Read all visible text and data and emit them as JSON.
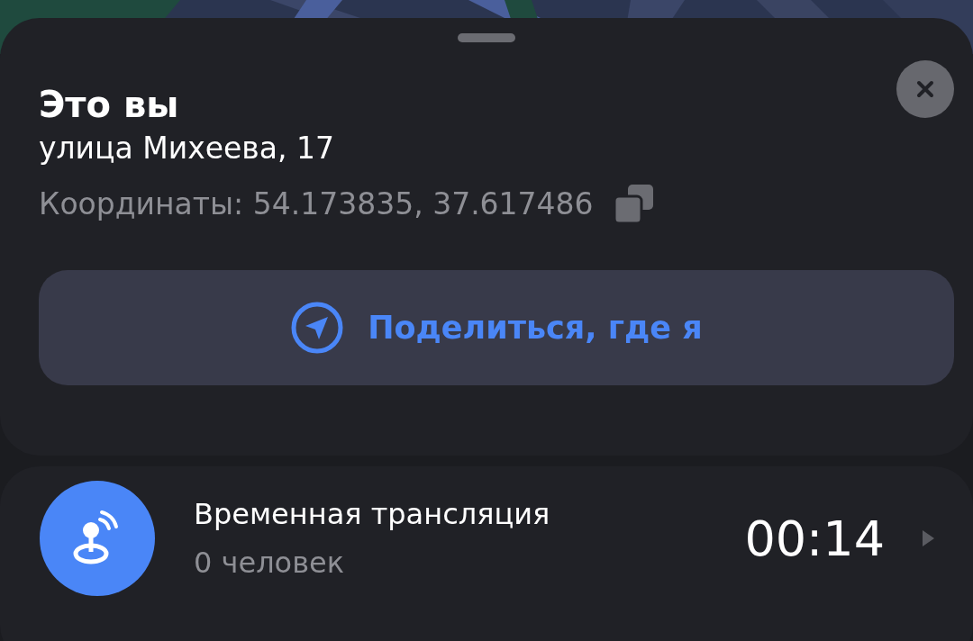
{
  "location_card": {
    "title": "Это вы",
    "address": "улица Михеева, 17",
    "coordinates": "Координаты: 54.173835, 37.617486",
    "share_button": {
      "label": "Поделиться, где я"
    }
  },
  "broadcast_card": {
    "title": "Временная трансляция",
    "subtitle": "0 человек",
    "timer": "00:14"
  }
}
